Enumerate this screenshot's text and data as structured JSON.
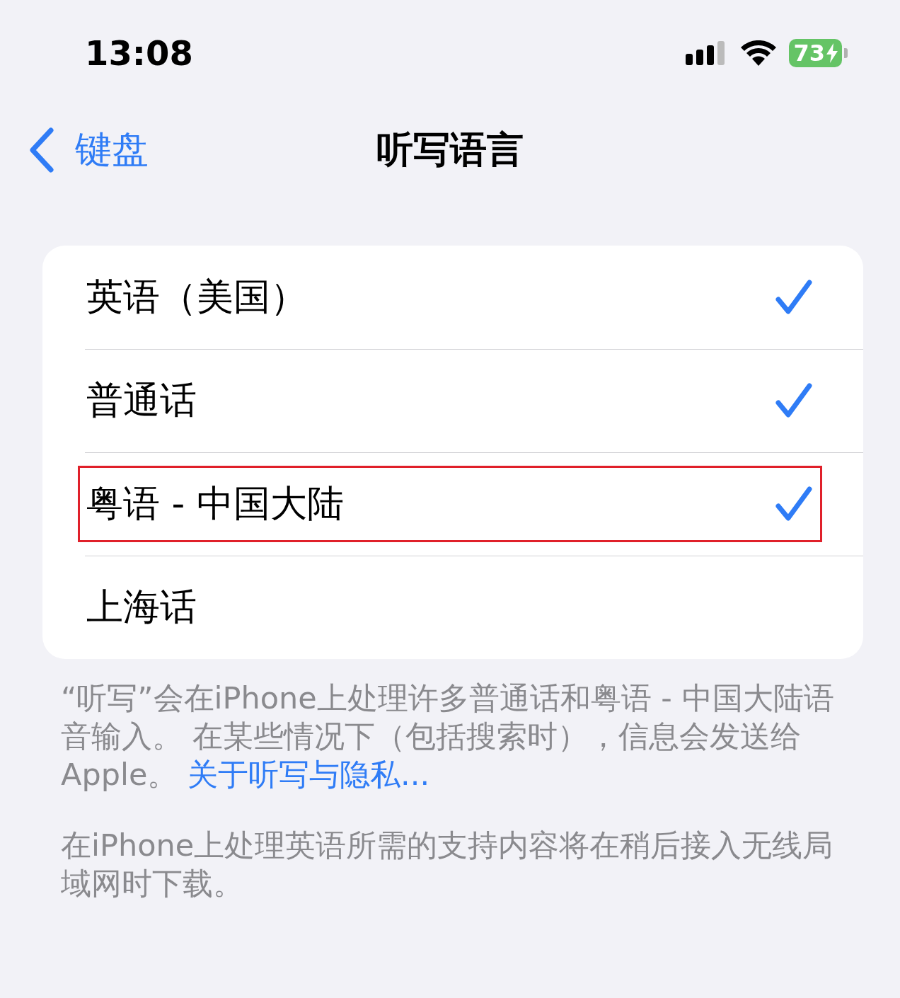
{
  "status_bar": {
    "time": "13:08",
    "battery": "73",
    "charging": true
  },
  "nav": {
    "back": "键盘",
    "title": "听写语言"
  },
  "languages": [
    {
      "label": "英语（美国）",
      "checked": true,
      "highlighted": false
    },
    {
      "label": "普通话",
      "checked": true,
      "highlighted": false
    },
    {
      "label": "粤语 - 中国大陆",
      "checked": true,
      "highlighted": true
    },
    {
      "label": "上海话",
      "checked": false,
      "highlighted": false
    }
  ],
  "footer": [
    {
      "text": "“听写”会在iPhone上处理许多普通话和粤语 - 中国大陆语音输入。 在某些情况下（包括搜索时），信息会发送给 Apple。",
      "link": "关于听写与隐私..."
    },
    {
      "text": "在iPhone上处理英语所需的支持内容将在稍后接入无线局域网时下载。"
    }
  ]
}
